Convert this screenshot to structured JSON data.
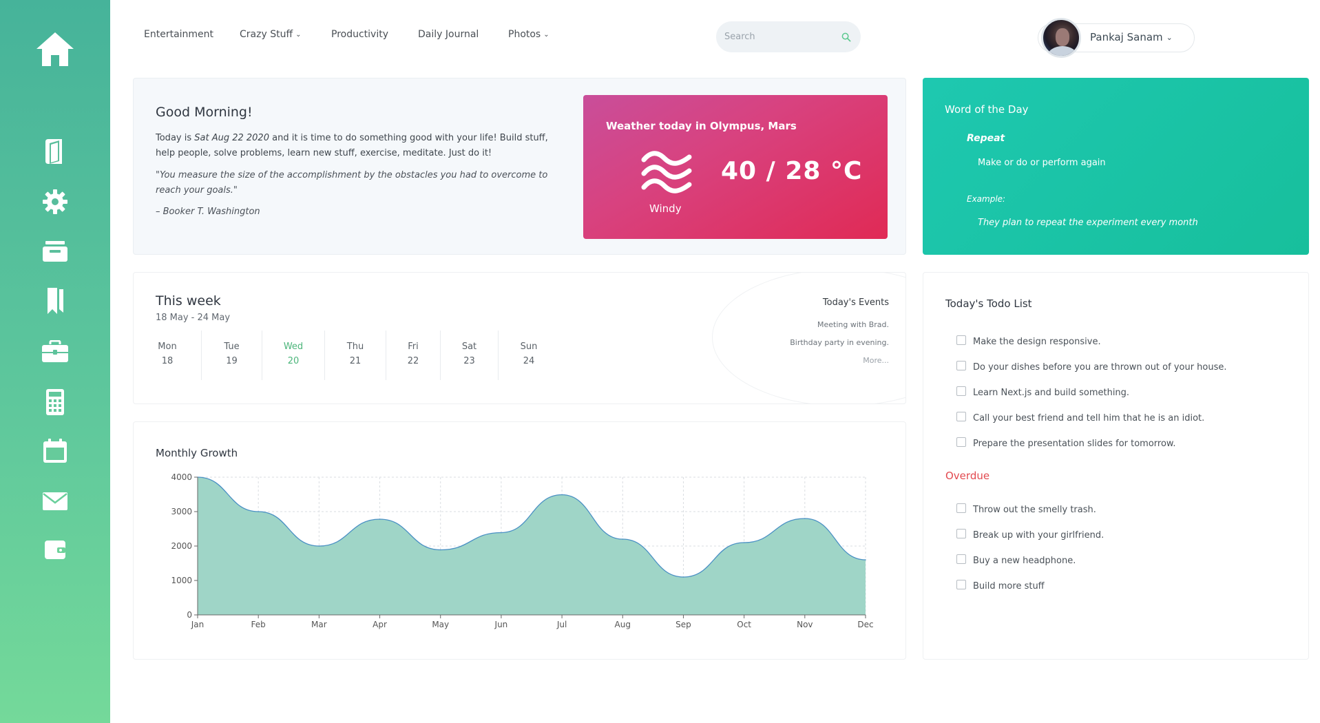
{
  "nav": {
    "items": [
      {
        "label": "Entertainment",
        "dropdown": false
      },
      {
        "label": "Crazy Stuff",
        "dropdown": true
      },
      {
        "label": "Productivity",
        "dropdown": false
      },
      {
        "label": "Daily Journal",
        "dropdown": false
      },
      {
        "label": "Photos",
        "dropdown": true
      }
    ],
    "search_placeholder": "Search",
    "user_name": "Pankaj Sanam"
  },
  "sidebar": {
    "icons": [
      "home-icon",
      "book-icon",
      "gear-icon",
      "inbox-icon",
      "bookmarks-icon",
      "briefcase-icon",
      "calculator-icon",
      "calendar-icon",
      "mail-icon",
      "wallet-icon"
    ]
  },
  "greeting": {
    "title": "Good Morning!",
    "text_prefix": "Today is ",
    "date": "Sat Aug 22 2020",
    "text_suffix": " and it is time to do something good with your life! Build stuff, help people, solve problems, learn new stuff, exercise, meditate. Just do it!",
    "quote": "\"You measure the size of the accomplishment by the obstacles you had to overcome to reach your goals.\"",
    "author": "– Booker T. Washington"
  },
  "weather": {
    "title": "Weather today in Olympus, Mars",
    "condition": "Windy",
    "temperature": "40 / 28 °C"
  },
  "word_of_day": {
    "title": "Word of the Day",
    "word": "Repeat",
    "definition": "Make or do or perform again",
    "example_label": "Example:",
    "example": "They plan to repeat the experiment every month"
  },
  "week": {
    "title": "This week",
    "range": "18 May - 24 May",
    "days": [
      {
        "name": "Mon",
        "date": "18",
        "active": false
      },
      {
        "name": "Tue",
        "date": "19",
        "active": false
      },
      {
        "name": "Wed",
        "date": "20",
        "active": true
      },
      {
        "name": "Thu",
        "date": "21",
        "active": false
      },
      {
        "name": "Fri",
        "date": "22",
        "active": false
      },
      {
        "name": "Sat",
        "date": "23",
        "active": false
      },
      {
        "name": "Sun",
        "date": "24",
        "active": false
      }
    ],
    "events_title": "Today's Events",
    "events": [
      "Meeting with Brad.",
      "Birthday party in evening."
    ],
    "more": "More..."
  },
  "growth": {
    "title": "Monthly Growth"
  },
  "chart_data": {
    "type": "area",
    "title": "Monthly Growth",
    "categories": [
      "Jan",
      "Feb",
      "Mar",
      "Apr",
      "May",
      "Jun",
      "Jul",
      "Aug",
      "Sep",
      "Oct",
      "Nov",
      "Dec"
    ],
    "values": [
      4000,
      3000,
      2000,
      2780,
      1890,
      2390,
      3490,
      2200,
      1100,
      2100,
      2800,
      1600
    ],
    "ylim": [
      0,
      4000
    ],
    "yticks": [
      0,
      1000,
      2000,
      3000,
      4000
    ],
    "grid": true,
    "fill_color": "#9fd5c7",
    "line_color": "#4a90c4"
  },
  "todo": {
    "title": "Today's Todo List",
    "items": [
      "Make the design responsive.",
      "Do your dishes before you are thrown out of your house.",
      "Learn Next.js and build something.",
      "Call your best friend and tell him that he is an idiot.",
      "Prepare the presentation slides for tomorrow."
    ],
    "overdue_title": "Overdue",
    "overdue": [
      "Throw out the smelly trash.",
      "Break up with your girlfriend.",
      "Buy a new headphone.",
      "Build more stuff"
    ]
  },
  "colors": {
    "sidebar_top": "#46b39a",
    "sidebar_bottom": "#74d99a",
    "weather_start": "#c94e9a",
    "weather_end": "#e02a55",
    "wotd": "#1ec8b0",
    "active_day": "#4bb57a",
    "overdue": "#e2494f"
  }
}
